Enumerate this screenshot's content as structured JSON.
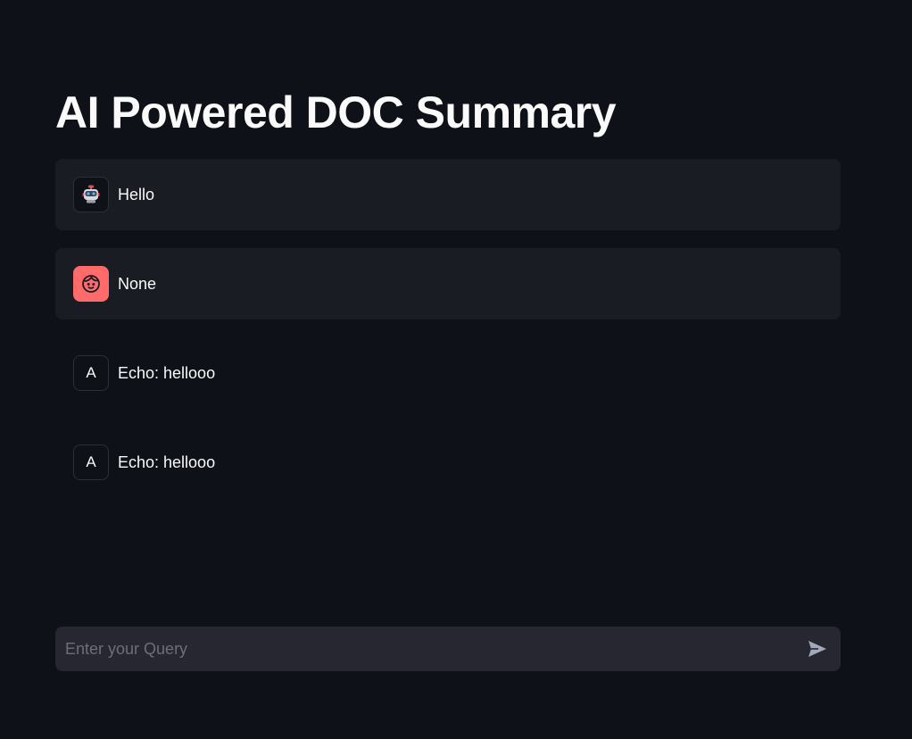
{
  "page": {
    "title": "AI Powered DOC Summary"
  },
  "messages": [
    {
      "role": "assistant",
      "avatar": "robot-icon",
      "text": "Hello",
      "style": "filled"
    },
    {
      "role": "user",
      "avatar": "user-face-icon",
      "text": "None",
      "style": "filled"
    },
    {
      "role": "A",
      "avatar_letter": "A",
      "text": "Echo: hellooo",
      "style": "plain"
    },
    {
      "role": "A",
      "avatar_letter": "A",
      "text": "Echo: hellooo",
      "style": "plain"
    }
  ],
  "chat_input": {
    "placeholder": "Enter your Query",
    "value": "",
    "send_icon": "send-icon"
  },
  "colors": {
    "background": "#0e1117",
    "message_bg": "#1a1c24",
    "input_bg": "#262730",
    "user_avatar": "#ff6b6b",
    "text": "#fafafa",
    "placeholder": "#6c6e79"
  }
}
